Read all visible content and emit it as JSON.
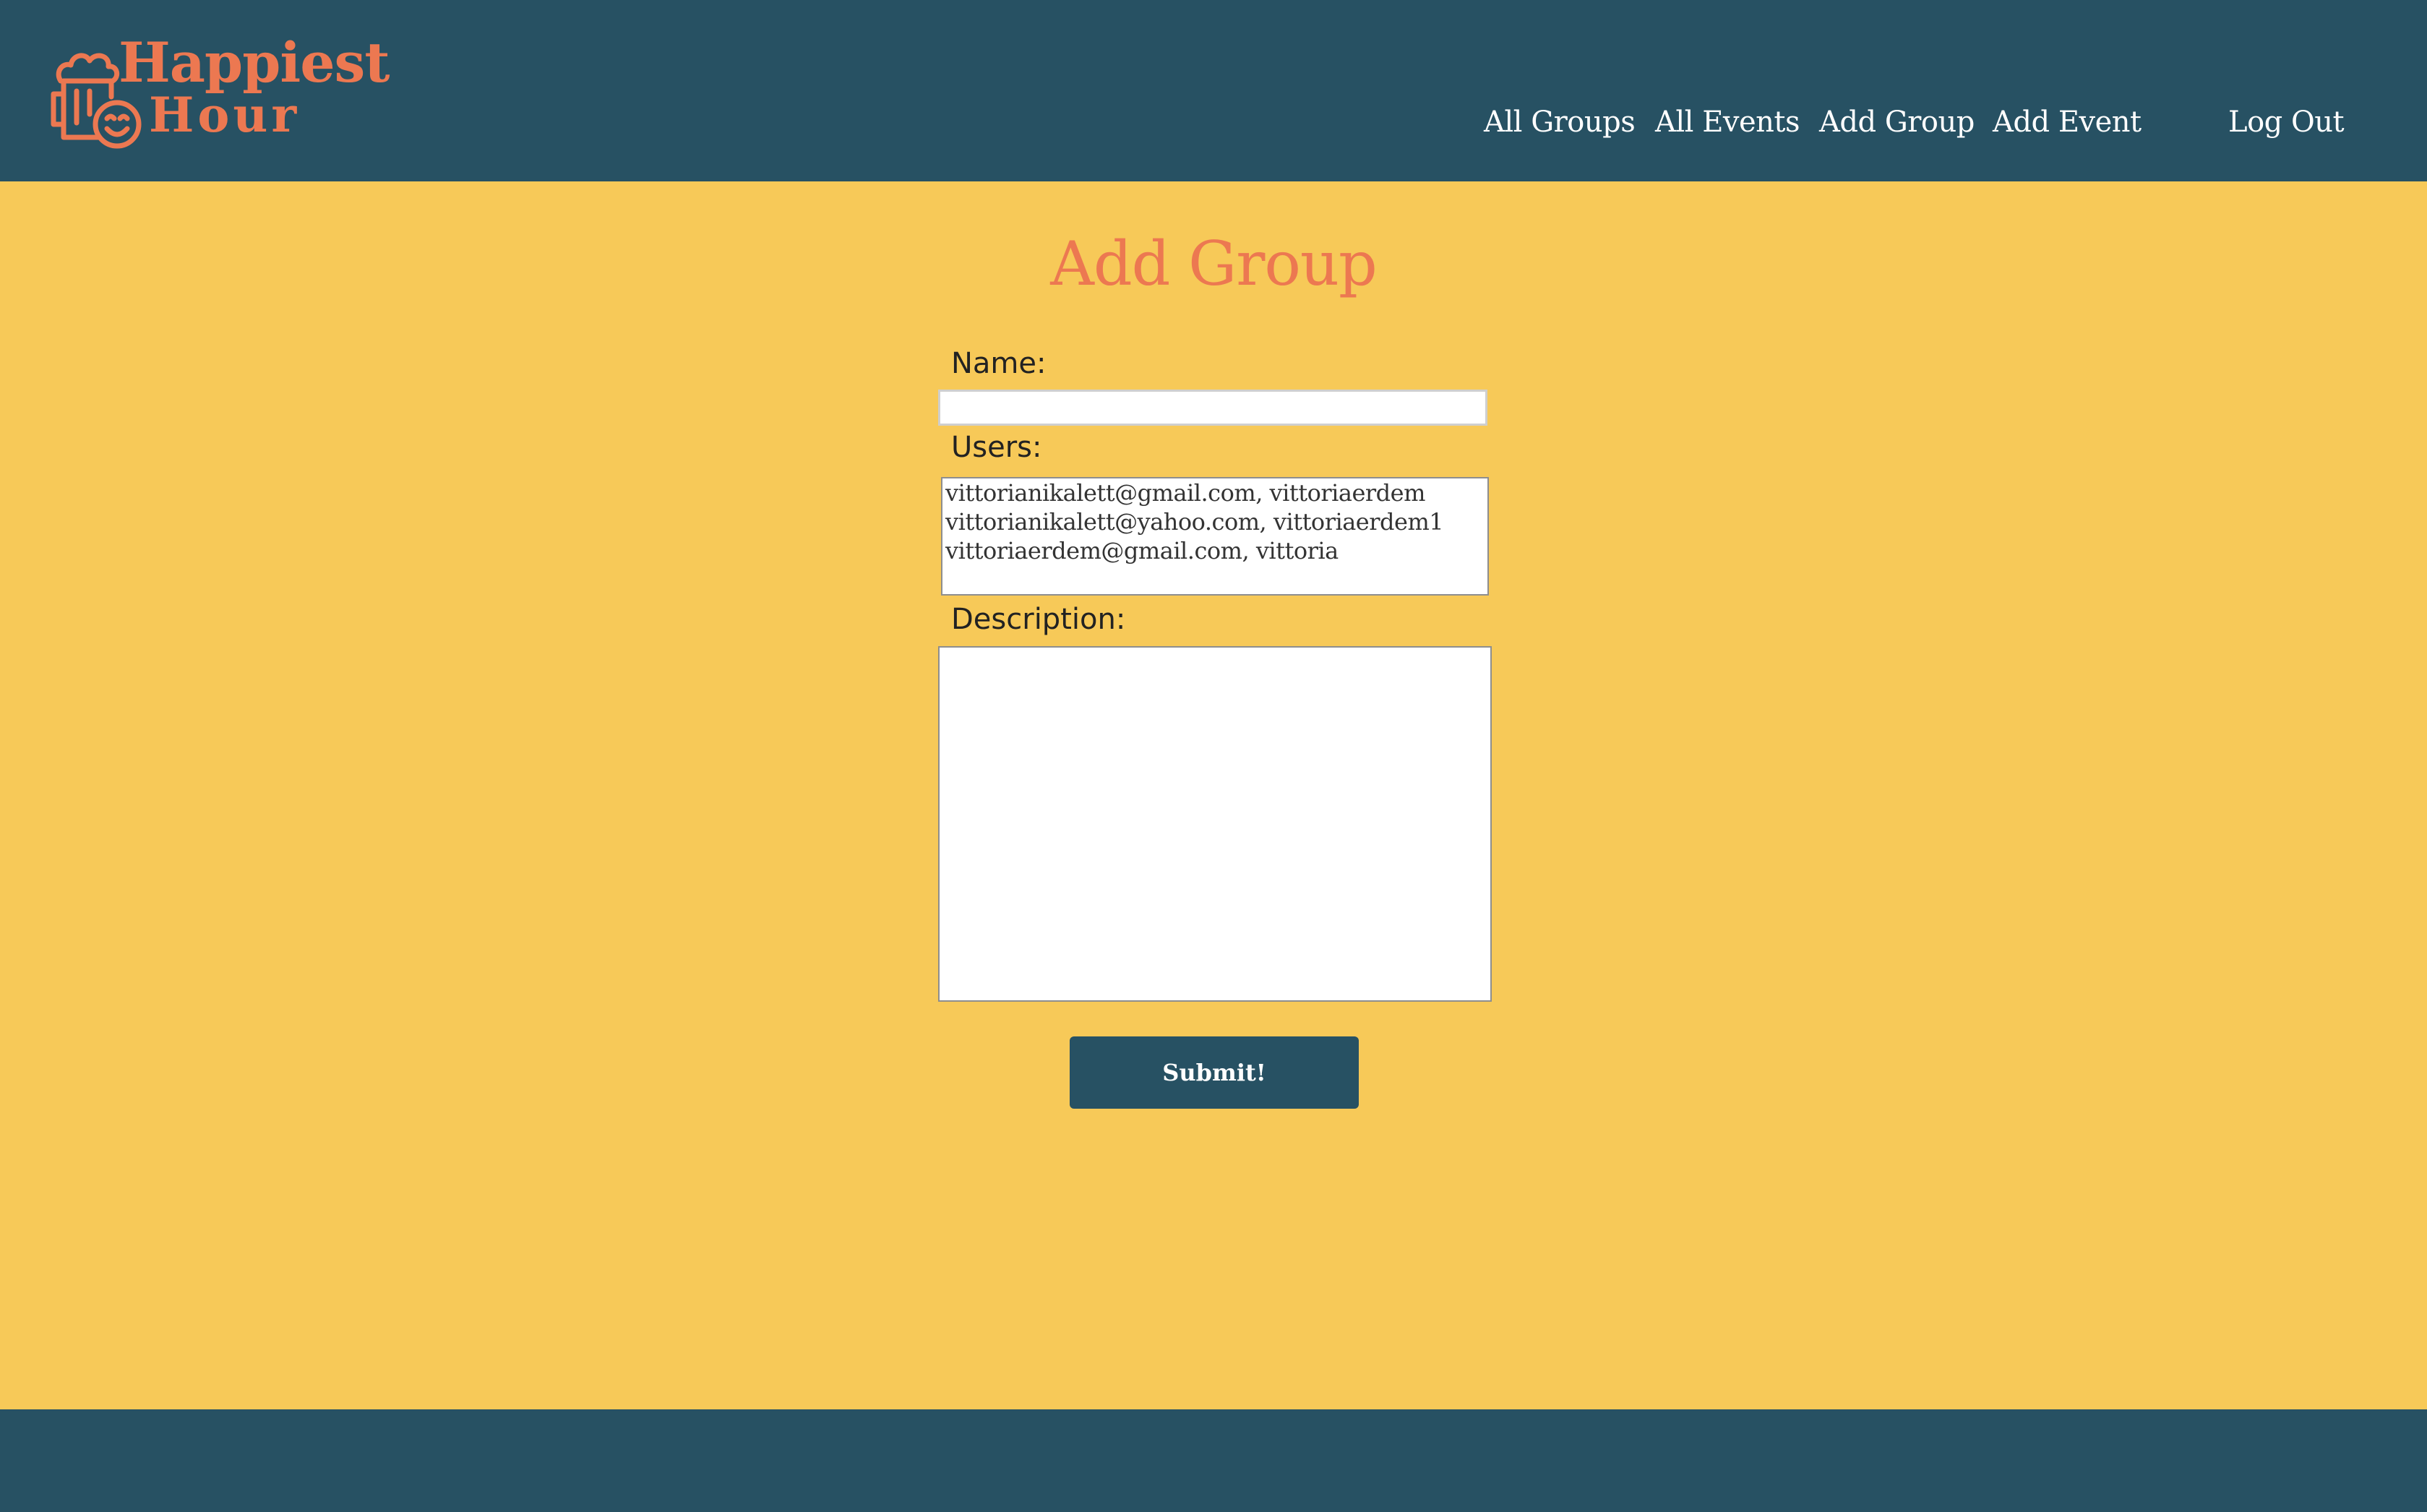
{
  "colors": {
    "header_bg": "#275163",
    "page_bg": "#f7c958",
    "brand_accent": "#ec7851",
    "button_bg": "#275163",
    "text_light": "#ffffff"
  },
  "header": {
    "logo": {
      "line1": "Happiest",
      "line2": "Hour",
      "icon": "beer-mug-smiley-icon"
    },
    "nav": {
      "all_groups": "All Groups",
      "all_events": "All Events",
      "add_group": "Add Group",
      "add_event": "Add Event",
      "log_out": "Log Out"
    }
  },
  "main": {
    "title": "Add Group",
    "form": {
      "name_label": "Name:",
      "name_value": "",
      "users_label": "Users:",
      "users_options": [
        "vittorianikalett@gmail.com, vittoriaerdem",
        "vittorianikalett@yahoo.com, vittoriaerdem1",
        "vittoriaerdem@gmail.com, vittoria"
      ],
      "description_label": "Description:",
      "description_value": "",
      "submit_label": "Submit!"
    }
  }
}
